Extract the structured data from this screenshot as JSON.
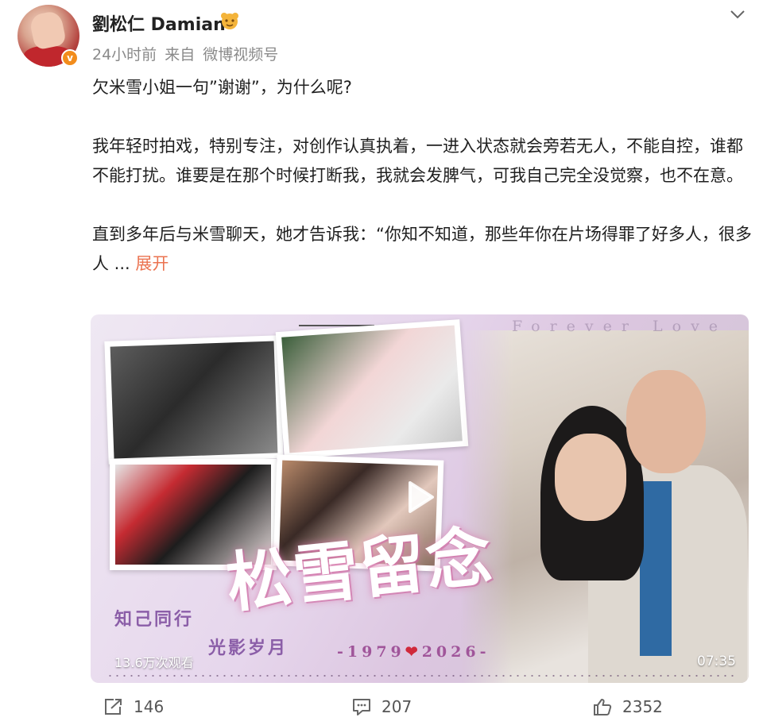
{
  "author": {
    "name": "劉松仁 Damian",
    "avatar_icon": "avatar-image",
    "verified_icon": "verified-orange-v",
    "verified_mark": "v",
    "badge_icon": "fan-badge-icon"
  },
  "meta": {
    "time": "24小时前",
    "source_prefix": "来自",
    "source": "微博视频号"
  },
  "post": {
    "para1": "欠米雪小姐一句”谢谢”，为什么呢?",
    "para2": "我年轻时拍戏，特别专注，对创作认真执着，一进入状态就会旁若无人，不能自控，谁都不能打扰。谁要是在那个时候打断我，我就会发脾气，可我自己完全没觉察，也不在意。",
    "para3": "直到多年后与米雪聊天，她才告诉我：“你知不知道，那些年你在片场得罪了好多人，很多人 ...",
    "expand_label": "展开",
    "expand_color": "#eb7350"
  },
  "video": {
    "overlay_top": "Forever Love",
    "title_art": "松雪留念",
    "subtitle1": "知己同行",
    "subtitle2": "光影岁月",
    "years_left": "-1979",
    "years_heart": "❤",
    "years_right": "2026-",
    "views": "13.6万次观看",
    "duration": "07:35",
    "play_icon": "play-icon"
  },
  "actions": {
    "share_count": "146",
    "comment_count": "207",
    "like_count": "2352"
  }
}
